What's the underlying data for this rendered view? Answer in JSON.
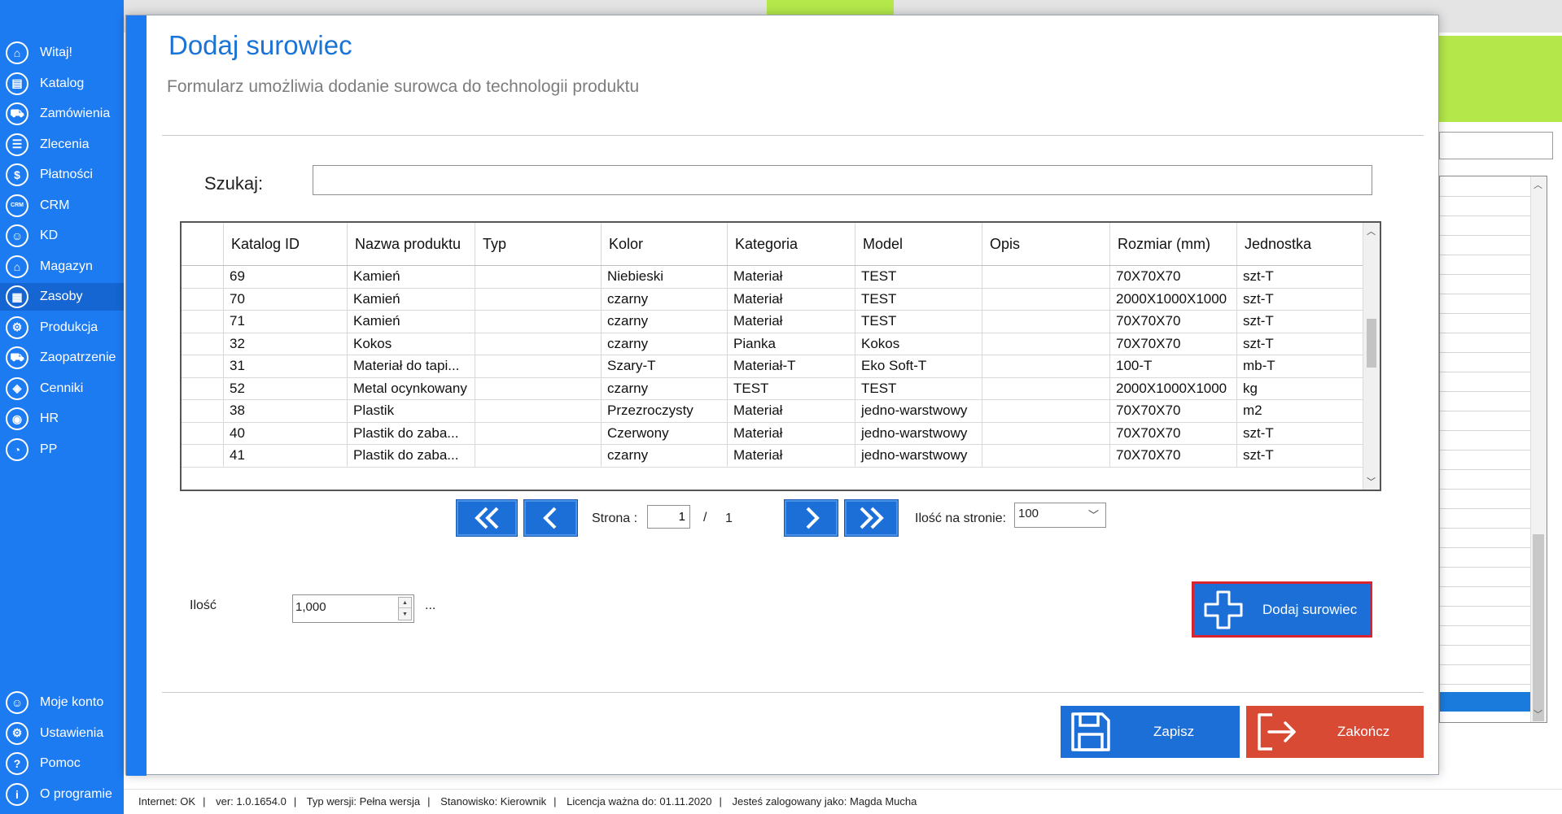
{
  "sidebar": {
    "items": [
      {
        "label": "Witaj!",
        "icon": "home-icon",
        "glyph": "⌂"
      },
      {
        "label": "Katalog",
        "icon": "book-icon",
        "glyph": "▤"
      },
      {
        "label": "Zamówienia",
        "icon": "cart-icon",
        "glyph": "⛟"
      },
      {
        "label": "Zlecenia",
        "icon": "list-icon",
        "glyph": "☰"
      },
      {
        "label": "Płatności",
        "icon": "dollar-icon",
        "glyph": "$"
      },
      {
        "label": "CRM",
        "icon": "crm-icon",
        "glyph": "CRM"
      },
      {
        "label": "KD",
        "icon": "person-icon",
        "glyph": "☺"
      },
      {
        "label": "Magazyn",
        "icon": "warehouse-icon",
        "glyph": "⌂"
      },
      {
        "label": "Zasoby",
        "icon": "resources-icon",
        "glyph": "▦"
      },
      {
        "label": "Produkcja",
        "icon": "production-icon",
        "glyph": "⚙"
      },
      {
        "label": "Zaopatrzenie",
        "icon": "truck-icon",
        "glyph": "⛟"
      },
      {
        "label": "Cenniki",
        "icon": "tag-icon",
        "glyph": "◈"
      },
      {
        "label": "HR",
        "icon": "hr-icon",
        "glyph": "◉"
      },
      {
        "label": "PP",
        "icon": "chart-icon",
        "glyph": "◔"
      }
    ],
    "bottom_items": [
      {
        "label": "Moje konto",
        "icon": "account-icon",
        "glyph": "☺"
      },
      {
        "label": "Ustawienia",
        "icon": "gear-icon",
        "glyph": "⚙"
      },
      {
        "label": "Pomoc",
        "icon": "help-icon",
        "glyph": "?"
      },
      {
        "label": "O programie",
        "icon": "info-icon",
        "glyph": "i"
      }
    ],
    "active_index": 8
  },
  "dialog": {
    "title": "Dodaj surowiec",
    "subtitle": "Formularz umożliwia dodanie surowca do technologii produktu",
    "search_label": "Szukaj:",
    "search_value": ""
  },
  "table": {
    "columns": [
      "",
      "Katalog ID",
      "Nazwa produktu",
      "Typ",
      "Kolor",
      "Kategoria",
      "Model",
      "Opis",
      "Rozmiar (mm)",
      "Jednostka"
    ],
    "rows": [
      [
        "",
        "69",
        "Kamień",
        "",
        "Niebieski",
        "Materiał",
        "TEST",
        "",
        "70X70X70",
        "szt-T"
      ],
      [
        "",
        "70",
        "Kamień",
        "",
        "czarny",
        "Materiał",
        "TEST",
        "",
        "2000X1000X1000",
        "szt-T"
      ],
      [
        "",
        "71",
        "Kamień",
        "",
        "czarny",
        "Materiał",
        "TEST",
        "",
        "70X70X70",
        "szt-T"
      ],
      [
        "",
        "32",
        "Kokos",
        "",
        "czarny",
        "Pianka",
        "Kokos",
        "",
        "70X70X70",
        "szt-T"
      ],
      [
        "",
        "31",
        "Materiał do tapi...",
        "",
        "Szary-T",
        "Materiał-T",
        "Eko Soft-T",
        "",
        "100-T",
        "mb-T"
      ],
      [
        "",
        "52",
        "Metal ocynkowany",
        "",
        "czarny",
        "TEST",
        "TEST",
        "",
        "2000X1000X1000",
        "kg"
      ],
      [
        "",
        "38",
        "Plastik",
        "",
        "Przezroczysty",
        "Materiał",
        "jedno-warstwowy",
        "",
        "70X70X70",
        "m2"
      ],
      [
        "",
        "40",
        "Plastik do zaba...",
        "",
        "Czerwony",
        "Materiał",
        "jedno-warstwowy",
        "",
        "70X70X70",
        "szt-T"
      ],
      [
        "",
        "41",
        "Plastik do zaba...",
        "",
        "czarny",
        "Materiał",
        "jedno-warstwowy",
        "",
        "70X70X70",
        "szt-T"
      ]
    ]
  },
  "pager": {
    "page_label": "Strona :",
    "current_page": "1",
    "separator": "/",
    "total_pages": "1",
    "per_page_label": "Ilość na stronie:",
    "per_page_value": "100"
  },
  "quantity": {
    "label": "Ilość",
    "value": "1,000",
    "more": "..."
  },
  "buttons": {
    "add": "Dodaj surowiec",
    "save": "Zapisz",
    "close": "Zakończ"
  },
  "status_bar": {
    "internet": "Internet: OK",
    "version": "ver: 1.0.1654.0",
    "edition": "Typ wersji: Pełna wersja",
    "position": "Stanowisko: Kierownik",
    "license": "Licencja ważna do: 01.11.2020",
    "user": "Jesteś zalogowany jako: Magda Mucha"
  },
  "colors": {
    "sidebar": "#1d7bf2",
    "accent_blue": "#1b6fd6",
    "close_red": "#d94a34",
    "highlight_border": "#d9232e",
    "lime": "#b4e84a"
  }
}
